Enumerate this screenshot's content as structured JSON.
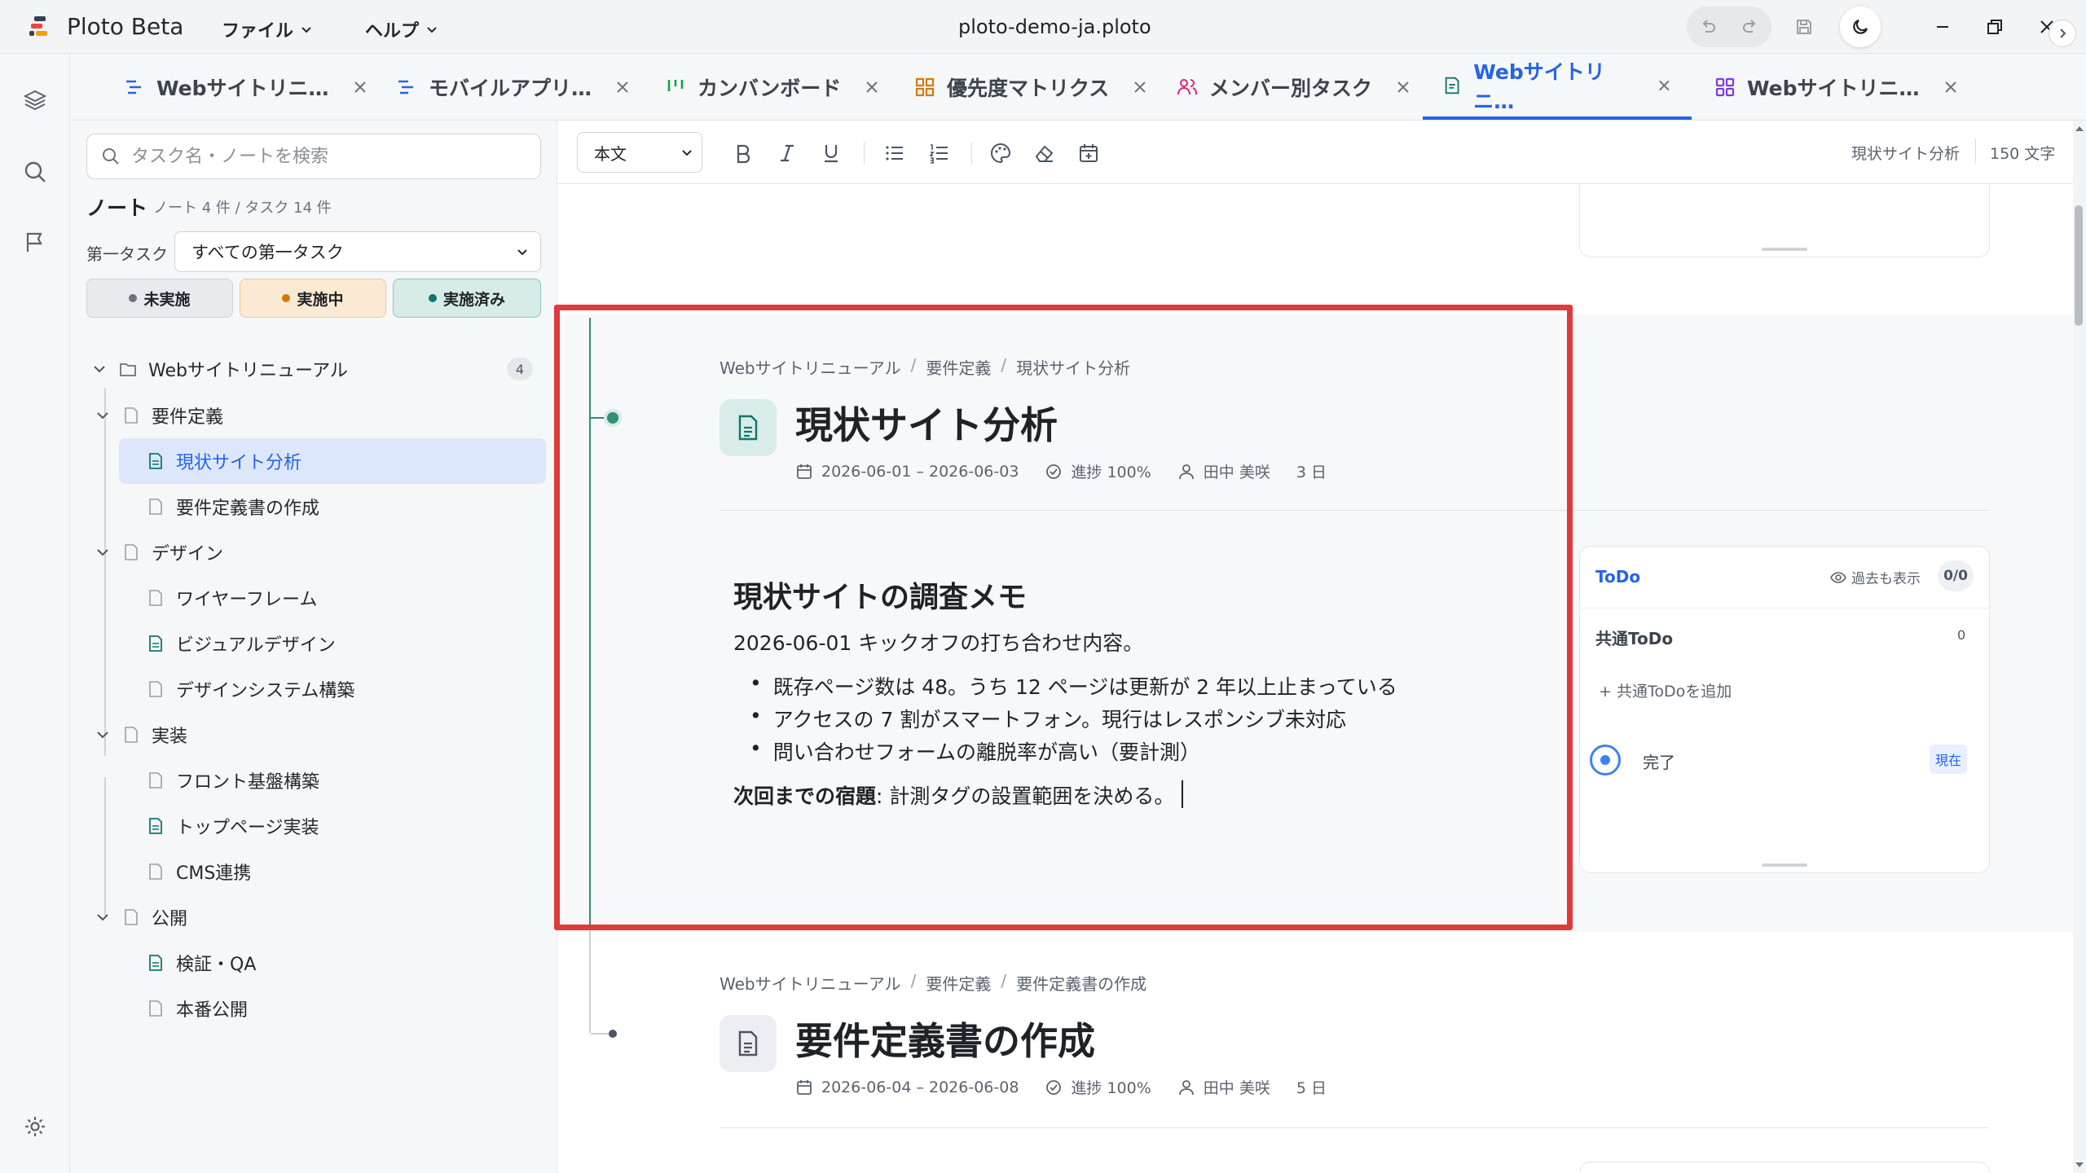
{
  "app": {
    "name": "Ploto Beta",
    "file_name": "ploto-demo-ja.ploto",
    "menus": [
      "ファイル",
      "ヘルプ"
    ]
  },
  "tabs": [
    {
      "label": "Webサイトリニ…",
      "icon": "gantt-icon",
      "active": false
    },
    {
      "label": "モバイルアプリ…",
      "icon": "gantt-icon",
      "active": false
    },
    {
      "label": "カンバンボード",
      "icon": "kanban-icon",
      "active": false
    },
    {
      "label": "優先度マトリクス",
      "icon": "matrix-icon",
      "active": false
    },
    {
      "label": "メンバー別タスク",
      "icon": "members-icon",
      "active": false
    },
    {
      "label": "Webサイトリニ…",
      "icon": "note-edit-icon",
      "active": true
    },
    {
      "label": "Webサイトリニ…",
      "icon": "grid-icon",
      "active": false
    }
  ],
  "sidebar": {
    "search_placeholder": "タスク名・ノートを検索",
    "notes_title": "ノート",
    "notes_count": "ノート 4 件 / タスク 14 件",
    "first_task_label": "第一タスク",
    "first_task_value": "すべての第一タスク",
    "status_chips": [
      {
        "label": "未実施",
        "color": "#6b7280"
      },
      {
        "label": "実施中",
        "color": "#d97706"
      },
      {
        "label": "実施済み",
        "color": "#0f766e"
      }
    ],
    "tree": {
      "project": {
        "label": "Webサイトリニューアル",
        "count": "4"
      },
      "groups": [
        {
          "label": "要件定義",
          "items": [
            {
              "label": "現状サイト分析",
              "has_note": true,
              "selected": true
            },
            {
              "label": "要件定義書の作成",
              "has_note": false
            }
          ]
        },
        {
          "label": "デザイン",
          "items": [
            {
              "label": "ワイヤーフレーム",
              "has_note": false
            },
            {
              "label": "ビジュアルデザイン",
              "has_note": true
            },
            {
              "label": "デザインシステム構築",
              "has_note": false
            }
          ]
        },
        {
          "label": "実装",
          "items": [
            {
              "label": "フロント基盤構築",
              "has_note": false
            },
            {
              "label": "トップページ実装",
              "has_note": true
            },
            {
              "label": "CMS連携",
              "has_note": false
            }
          ]
        },
        {
          "label": "公開",
          "items": [
            {
              "label": "検証・QA",
              "has_note": true
            },
            {
              "label": "本番公開",
              "has_note": false
            }
          ]
        }
      ]
    }
  },
  "toolbar": {
    "format_value": "本文",
    "breadcrumb_right": "現状サイト分析",
    "char_count": "150 文字"
  },
  "doc1": {
    "breadcrumb": [
      "Webサイトリニューアル",
      "要件定義",
      "現状サイト分析"
    ],
    "title": "現状サイト分析",
    "dates": "2026-06-01 – 2026-06-03",
    "progress": "進捗 100%",
    "assignee": "田中 美咲",
    "duration": "3 日"
  },
  "note": {
    "heading": "現状サイトの調査メモ",
    "intro": "2026-06-01 キックオフの打ち合わせ内容。",
    "bullets": [
      "既存ページ数は 48。うち 12 ページは更新が 2 年以上止まっている",
      "アクセスの 7 割がスマートフォン。現行はレスポンシブ未対応",
      "問い合わせフォームの離脱率が高い（要計測）"
    ],
    "homework_label": "次回までの宿題",
    "homework_text": ": 計測タグの設置範囲を決める。"
  },
  "todo": {
    "title": "ToDo",
    "show_past": "過去も表示",
    "count": "0/0",
    "shared_title": "共通ToDo",
    "shared_count": "0",
    "add_shared": "+ 共通ToDoを追加",
    "done_label": "完了",
    "now_badge": "現在"
  },
  "doc2": {
    "breadcrumb": [
      "Webサイトリニューアル",
      "要件定義",
      "要件定義書の作成"
    ],
    "title": "要件定義書の作成",
    "dates": "2026-06-04 – 2026-06-08",
    "progress": "進捗 100%",
    "assignee": "田中 美咲",
    "duration": "5 日"
  },
  "colors": {
    "accent": "#2563eb",
    "teal": "#0f766e",
    "highlight": "#e03a3a"
  }
}
